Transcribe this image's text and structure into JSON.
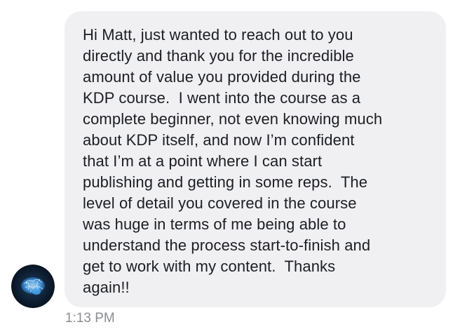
{
  "message": {
    "sender_avatar_icon": "brain-avatar-icon",
    "text": "Hi Matt, just wanted to reach out to you\ndirectly and thank you for the incredible\namount of value you provided during the\nKDP course.  I went into the course as a\ncomplete beginner, not even knowing much\nabout KDP itself, and now I’m confident\nthat I’m at a point where I can start\npublishing and getting in some reps.  The\nlevel of detail you covered in the course\nwas huge in terms of me being able to\nunderstand the process start-to-finish and\nget to work with my content.  Thanks\nagain!!",
    "timestamp": "1:13 PM"
  },
  "colors": {
    "bubble_background": "#f0f0f3",
    "text": "#1c1e21",
    "timestamp": "#8a8d91",
    "avatar_background": "#0b1a2b",
    "avatar_glow": "#5fb8ff"
  }
}
